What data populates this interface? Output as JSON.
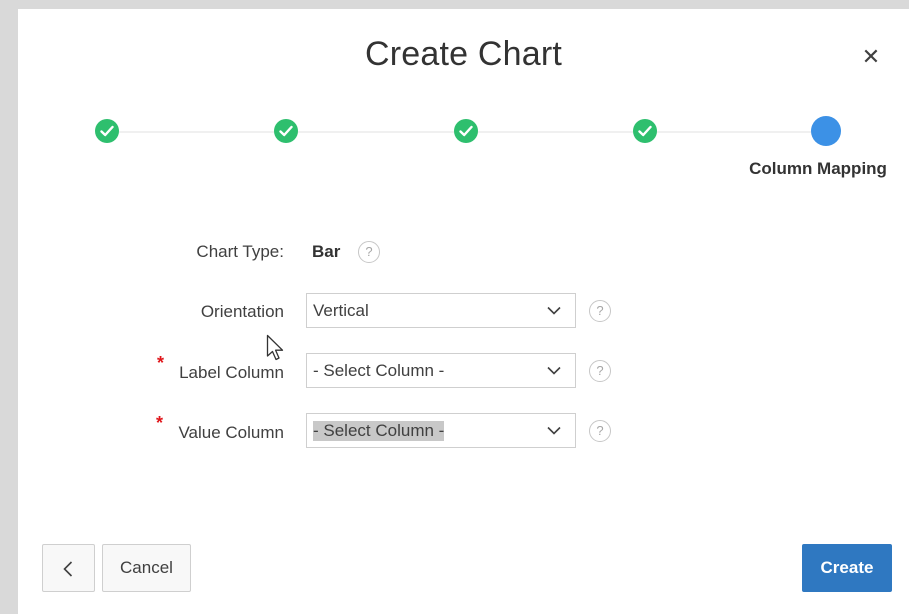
{
  "dialog": {
    "title": "Create Chart",
    "close_icon": "close-icon"
  },
  "wizard": {
    "completed_steps": 4,
    "current_step_label": "Column Mapping",
    "colors": {
      "done": "#2ebf6e",
      "current": "#3c91e6"
    }
  },
  "form": {
    "chart_type": {
      "label": "Chart Type:",
      "value": "Bar"
    },
    "orientation": {
      "label": "Orientation",
      "value": "Vertical"
    },
    "label_column": {
      "label": "Label Column",
      "value": "- Select Column -",
      "required": "*"
    },
    "value_column": {
      "label": "Value Column",
      "value": "- Select Column -",
      "required": "*"
    }
  },
  "footer": {
    "back_icon": "chevron-left-icon",
    "cancel_label": "Cancel",
    "create_label": "Create",
    "create_color": "#2f78c1"
  }
}
